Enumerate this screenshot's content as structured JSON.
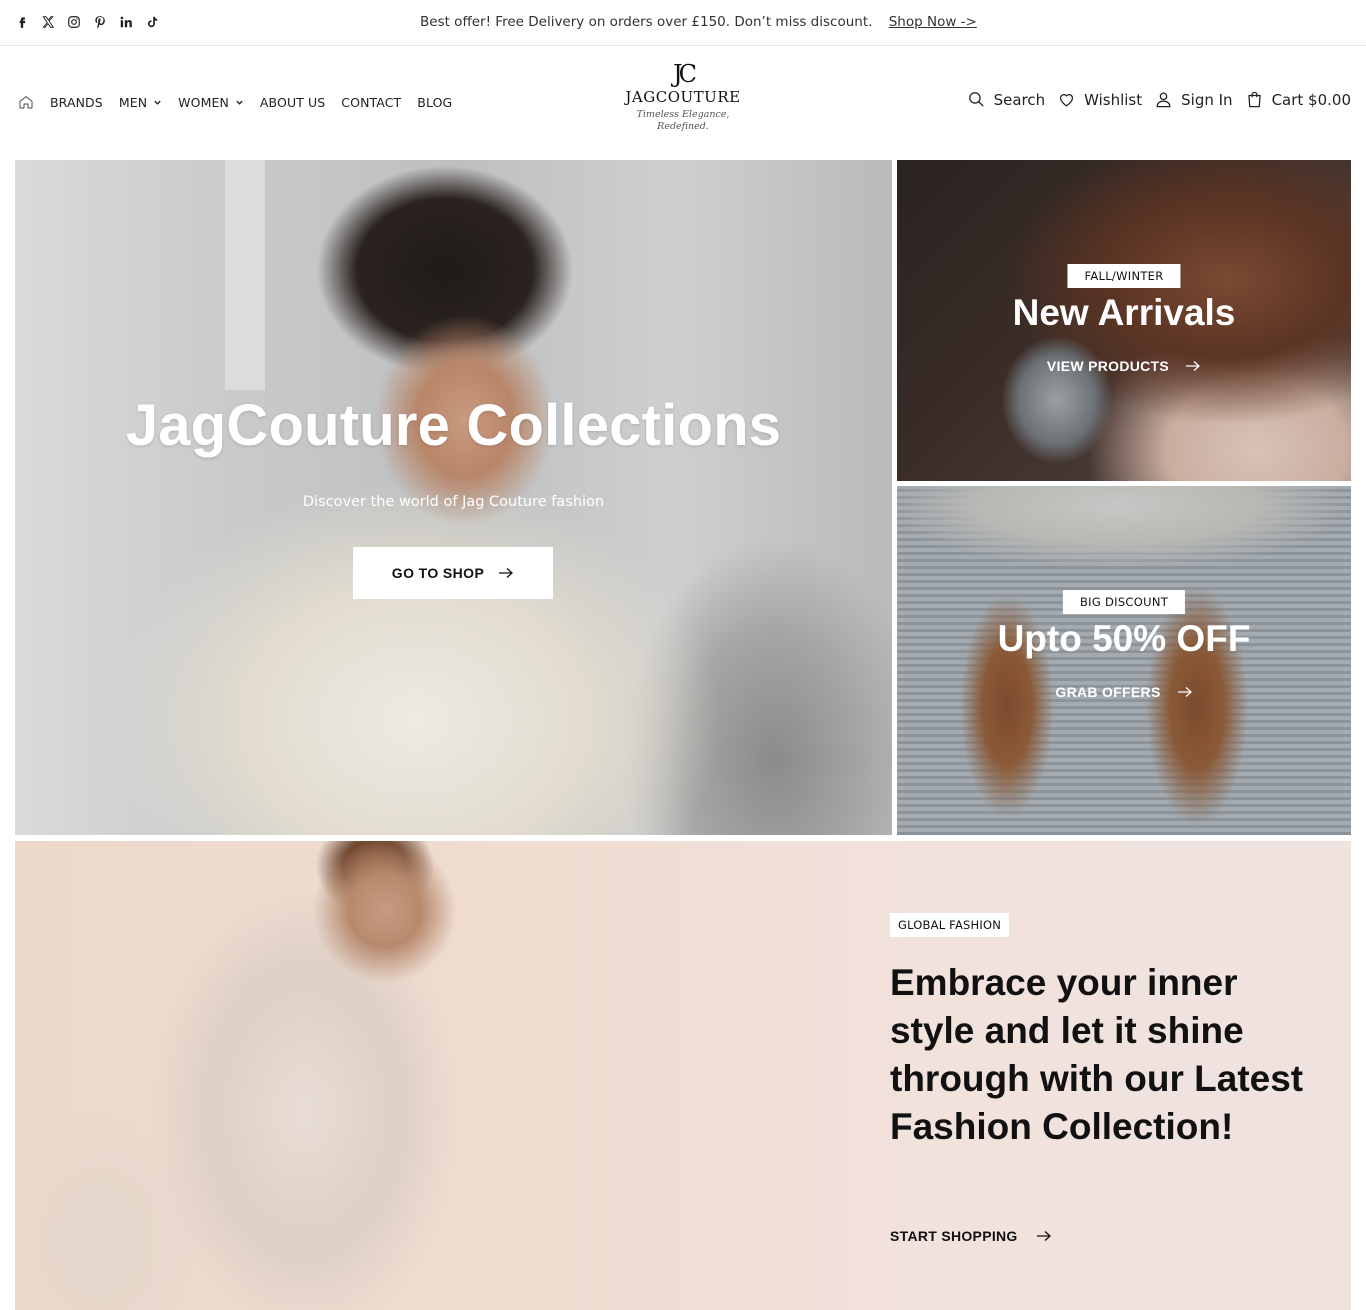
{
  "topbar": {
    "social_icons": [
      "facebook-icon",
      "x-icon",
      "instagram-icon",
      "pinterest-icon",
      "linkedin-icon",
      "tiktok-icon"
    ],
    "offer_text": "Best offer! Free Delivery on orders over £150. Don’t miss discount.",
    "shop_now": "Shop Now ->"
  },
  "nav": {
    "items": [
      {
        "label": "BRANDS",
        "has_dropdown": false
      },
      {
        "label": "MEN",
        "has_dropdown": true
      },
      {
        "label": "WOMEN",
        "has_dropdown": true
      },
      {
        "label": "ABOUT US",
        "has_dropdown": false
      },
      {
        "label": "CONTACT",
        "has_dropdown": false
      },
      {
        "label": "BLOG",
        "has_dropdown": false
      }
    ]
  },
  "logo": {
    "monogram": "JC",
    "brand": "JAGCOUTURE",
    "tagline_1": "Timeless Elegance,",
    "tagline_2": "Redefined."
  },
  "header_actions": {
    "search": "Search",
    "wishlist": "Wishlist",
    "sign_in": "Sign In",
    "cart": "Cart $0.00"
  },
  "hero": {
    "title": "JagCouture Collections",
    "subtitle": "Discover the world of Jag Couture fashion",
    "button": "GO TO SHOP"
  },
  "tiles": {
    "arrivals": {
      "tag": "FALL/WINTER",
      "title": "New Arrivals",
      "link": "VIEW PRODUCTS"
    },
    "discount": {
      "tag": "BIG DISCOUNT",
      "title": "Upto 50% OFF",
      "link": "GRAB OFFERS"
    }
  },
  "banner": {
    "tag": "GLOBAL FASHION",
    "title": "Embrace your inner style and let it shine through with our Latest Fashion Collection!",
    "link": "START SHOPPING"
  },
  "colors": {
    "text": "#111111",
    "banner_bg": "#f0e2dc",
    "white": "#ffffff"
  }
}
